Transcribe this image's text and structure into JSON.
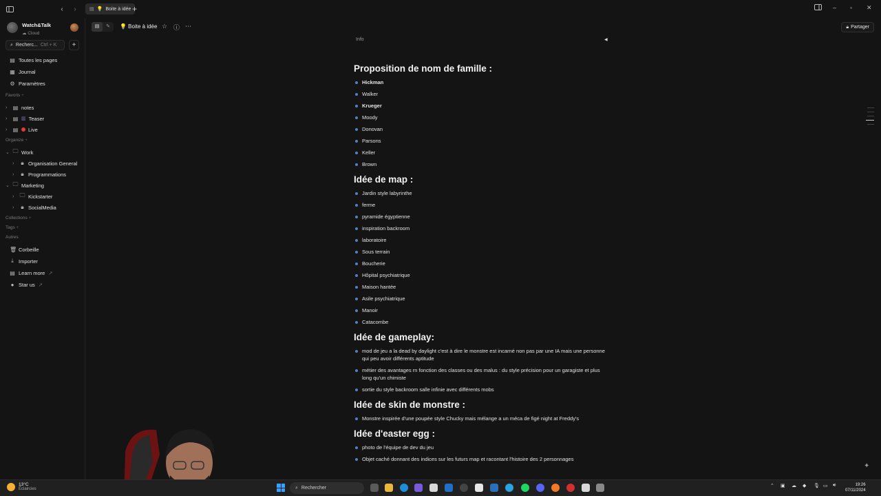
{
  "tabbar": {
    "tab_title": "Boite à idée",
    "tab_icon": "💡"
  },
  "sidebar": {
    "workspace_name": "Watch&Talk",
    "workspace_sub": "Cloud",
    "search_label": "Recherc...",
    "search_shortcut": "Ctrl + K",
    "nav": [
      {
        "label": "Toutes les pages",
        "icon": "pages-icon"
      },
      {
        "label": "Journal",
        "icon": "journal-icon"
      },
      {
        "label": "Paramètres",
        "icon": "settings-icon"
      }
    ],
    "favoris_label": "Favoris",
    "favoris": [
      {
        "label": "notes"
      },
      {
        "label": "Teaser"
      },
      {
        "label": "Live"
      }
    ],
    "organize_label": "Organize",
    "organize": [
      {
        "label": "Work"
      },
      {
        "label": "Organisation General"
      },
      {
        "label": "Programmations"
      },
      {
        "label": "Marketing"
      },
      {
        "label": "Kickstarter"
      },
      {
        "label": "SocialMedia"
      }
    ],
    "collections_label": "Collections",
    "tags_label": "Tags",
    "autres_label": "Autres",
    "autres": [
      {
        "label": "Corbeille"
      },
      {
        "label": "Importer"
      },
      {
        "label": "Learn more"
      },
      {
        "label": "Star us"
      }
    ]
  },
  "header": {
    "doc_title": "💡 Boite à idée",
    "share_label": "Partager"
  },
  "doc": {
    "info_label": "Info",
    "sections": [
      {
        "heading": "Proposition de nom de famille :",
        "items": [
          "Hickman",
          "Walker",
          "Krueger",
          "Moody",
          "Donovan",
          "Parsons",
          "Keller",
          "Brown"
        ]
      },
      {
        "heading": "Idée de map :",
        "items": [
          "Jardin style labyrinthe",
          "ferme",
          "pyramide égyptienne",
          "inspiration backroom",
          "laboratoire",
          "Sous terrain",
          "Boucherie",
          "Hôpital psychiatrique",
          "Maison hantée",
          "Asile psychiatrique",
          "Manoir",
          "Catacombe"
        ]
      },
      {
        "heading": "Idée de gameplay:",
        "items": [
          "mod de jeu a la dead by daylight c'est à dire le monstre est incarné non pas par une IA mais une personne qui peu avoir différents aptitude",
          "métier des avantages rn fonction des classes ou des malus : du style précision pour un garagiste et plus long qu'un chimiste",
          "sortie du style backroom salle infinie avec différents mobs"
        ]
      },
      {
        "heading": "Idée de skin de monstre :",
        "items": [
          "Monstre inspirée d'une poupée style Chucky mais mélange a un méca de figé night at Freddy's"
        ]
      },
      {
        "heading": "Idée d'easter egg :",
        "items": [
          "photo de l'équipe de dev du jeu",
          "Objet caché donnant des indices sur les futurs map et racontant l'histoire des 2 personnages"
        ]
      }
    ]
  },
  "taskbar": {
    "weather_temp": "13°C",
    "weather_desc": "Éclaircies",
    "search_label": "Rechercher",
    "time": "19:26",
    "date": "07/11/2024"
  },
  "colors": {
    "background": "#141414",
    "bullet": "#5a7fc0",
    "accent_windows": "#3aa0ff"
  }
}
